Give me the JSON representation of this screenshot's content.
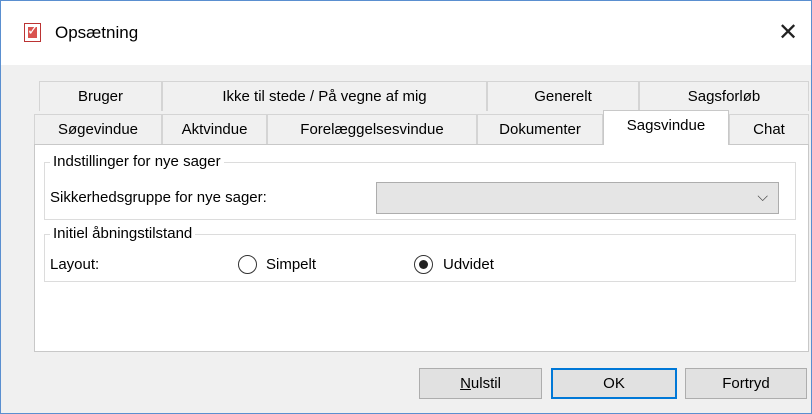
{
  "window": {
    "title": "Opsætning",
    "close_glyph": "✕"
  },
  "tabs_row1": [
    "Bruger",
    "Ikke til stede / På vegne af mig",
    "Generelt",
    "Sagsforløb"
  ],
  "tabs_row2": [
    "Søgevindue",
    "Aktvindue",
    "Forelæggelsesvindue",
    "Dokumenter",
    "Sagsvindue",
    "Chat"
  ],
  "selected_tab": "Sagsvindue",
  "group_new_cases": {
    "label": "Indstillinger for nye sager",
    "security_label": "Sikkerhedsgruppe for nye sager:",
    "security_value": ""
  },
  "group_open_state": {
    "label": "Initiel åbningstilstand",
    "layout_label": "Layout:",
    "options": [
      "Simpelt",
      "Udvidet"
    ],
    "selected": "Udvidet"
  },
  "buttons": {
    "reset_label": "Nulstil",
    "reset_underline": "N",
    "reset_rest": "ulstil",
    "ok_label": "OK",
    "cancel_label": "Fortryd"
  },
  "icons": {
    "app": "checklist-icon",
    "close": "close-icon",
    "dropdown": "chevron-down-icon"
  }
}
